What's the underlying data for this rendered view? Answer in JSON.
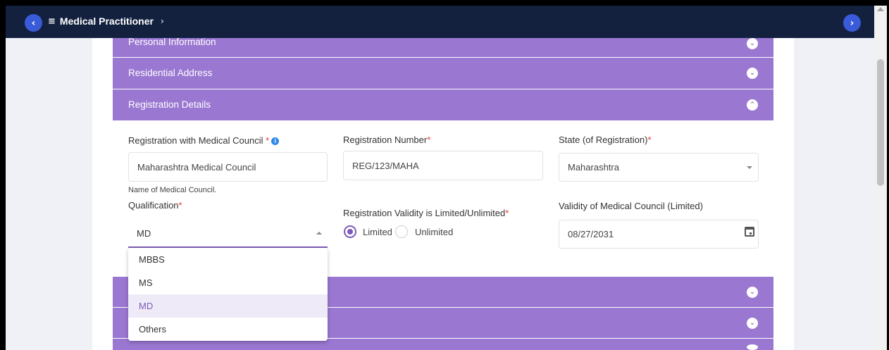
{
  "header": {
    "title": "Medical Practitioner",
    "back_glyph": "‹",
    "forward_glyph": "›",
    "menu_glyph": "≡",
    "separator": "›"
  },
  "sections": {
    "personal": {
      "title": "Personal Information"
    },
    "residential": {
      "title": "Residential Address"
    },
    "registration": {
      "title": "Registration Details"
    }
  },
  "form": {
    "council": {
      "label": "Registration with Medical Council",
      "value": "Maharashtra Medical Council",
      "helper": "Name of Medical Council."
    },
    "reg_number": {
      "label": "Registration Number",
      "value": "REG/123/MAHA"
    },
    "state": {
      "label": "State (of Registration)",
      "value": "Maharashtra"
    },
    "qualification": {
      "label": "Qualification",
      "value": "MD",
      "options": [
        "MBBS",
        "MS",
        "MD",
        "Others"
      ]
    },
    "validity_type": {
      "label": "Registration Validity is Limited/Unlimited",
      "options": [
        "Limited",
        "Unlimited"
      ],
      "selected": "Limited"
    },
    "validity_date": {
      "label": "Validity of Medical Council (Limited)",
      "value": "08/27/2031"
    }
  },
  "required_mark": "*",
  "info_glyph": "i",
  "chevron_down": "⌄",
  "chevron_up": "⌃",
  "icons": {
    "calendar": "calendar-icon",
    "info": "info-icon"
  },
  "colors": {
    "header_bg": "#13213f",
    "accordion_bg": "#9a77d1",
    "accent": "#7b5cb8",
    "nav_button": "#3a5bd9",
    "required": "#e53935",
    "selected_option_bg": "#efeaf8"
  }
}
